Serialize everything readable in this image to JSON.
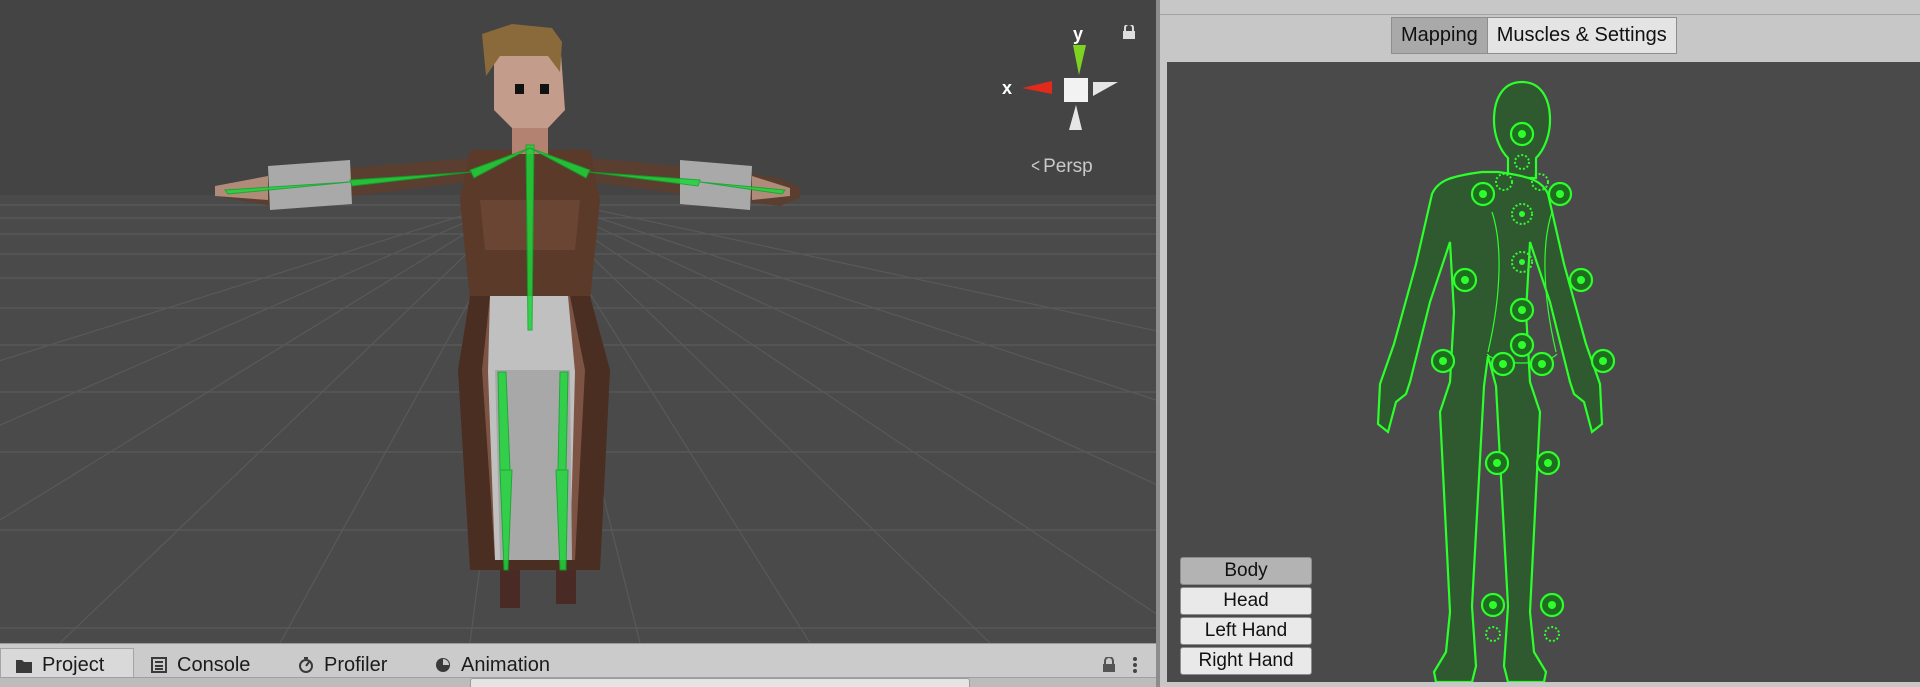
{
  "scene": {
    "gizmo": {
      "y_label": "y",
      "x_label": "x",
      "lock_icon": "lock-icon"
    },
    "projection_label": "Persp"
  },
  "bottom_tabs": [
    {
      "label": "Project",
      "icon": "folder-icon",
      "active": true
    },
    {
      "label": "Console",
      "icon": "console-icon",
      "active": false
    },
    {
      "label": "Profiler",
      "icon": "profiler-icon",
      "active": false
    },
    {
      "label": "Animation",
      "icon": "animation-icon",
      "active": false
    }
  ],
  "avatar_panel": {
    "tabs": [
      {
        "label": "Mapping",
        "active": true
      },
      {
        "label": "Muscles & Settings",
        "active": false
      }
    ],
    "body_parts": [
      {
        "label": "Body",
        "active": true
      },
      {
        "label": "Head",
        "active": false
      },
      {
        "label": "Left Hand",
        "active": false
      },
      {
        "label": "Right Hand",
        "active": false
      }
    ],
    "bone_color": "#22c422"
  }
}
